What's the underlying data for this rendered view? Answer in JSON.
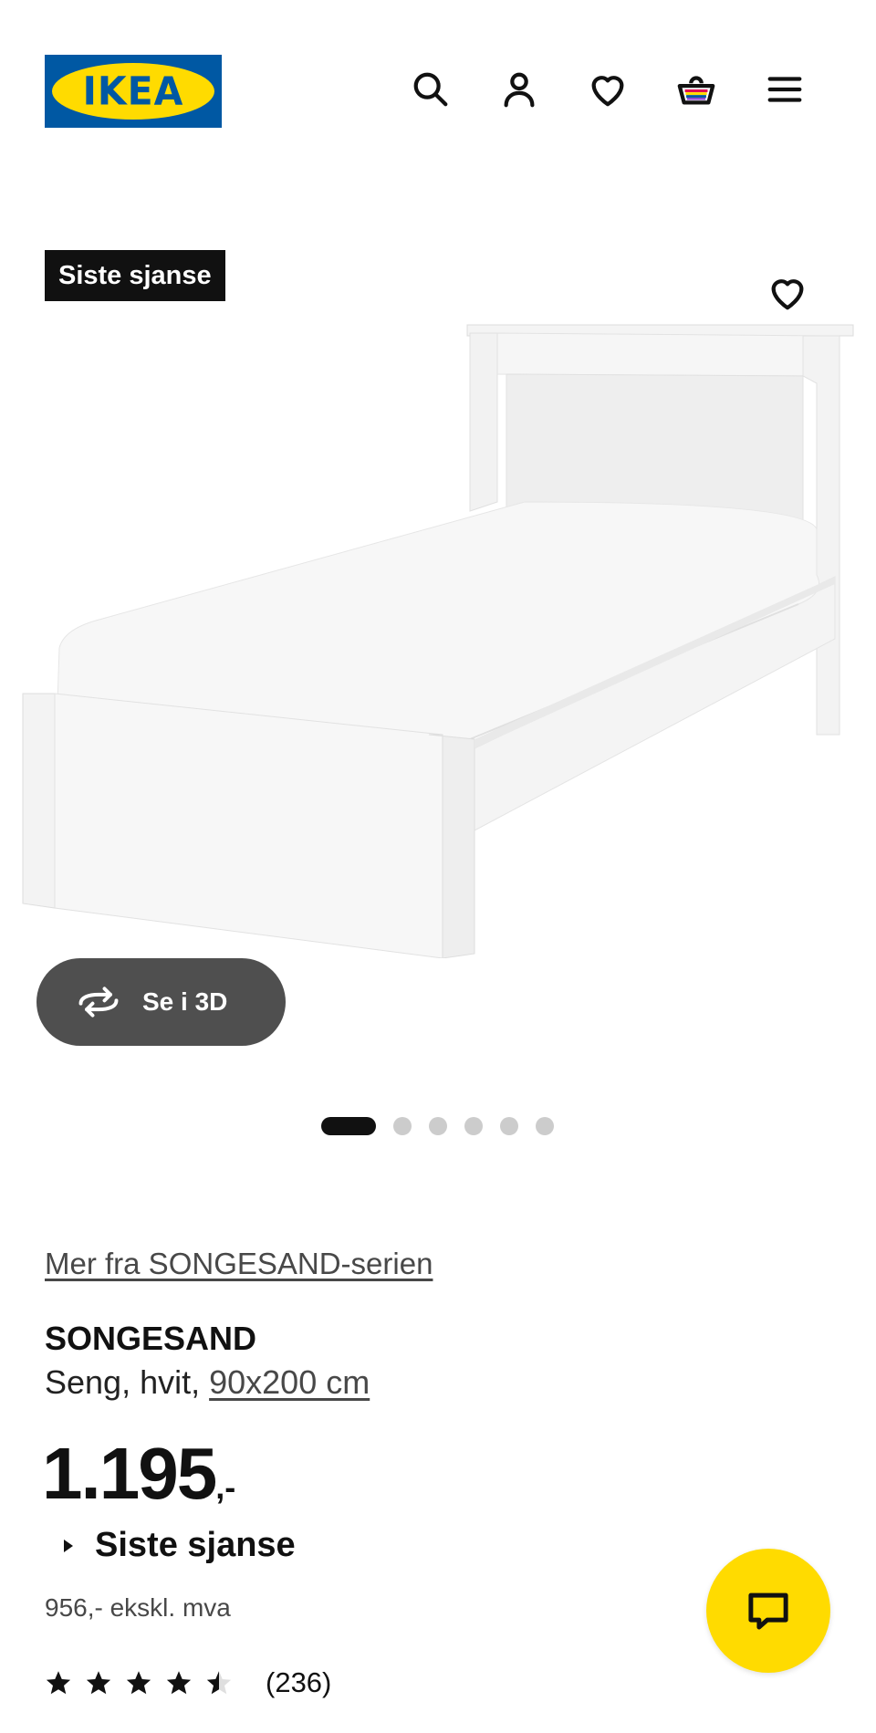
{
  "header": {
    "logo_text": "IKEA",
    "icons": [
      "search-icon",
      "account-icon",
      "heart-icon",
      "cart-icon",
      "menu-icon"
    ]
  },
  "gallery": {
    "badge": "Siste sjanse",
    "view_3d_label": "Se i 3D",
    "image_count": 6,
    "active_index": 0
  },
  "product": {
    "series_link": "Mer fra SONGESAND-serien",
    "name": "SONGESAND",
    "description": "Seng, hvit, ",
    "size": "90x200 cm",
    "price_main": "1.195",
    "price_suffix": ",-",
    "promo": "Siste sjanse",
    "ex_vat": "956,- ekskl. mva",
    "rating": 4.5,
    "rating_count": "(236)"
  },
  "colors": {
    "ikea_blue": "#0058a3",
    "ikea_yellow": "#ffdb00",
    "dark": "#111111"
  }
}
